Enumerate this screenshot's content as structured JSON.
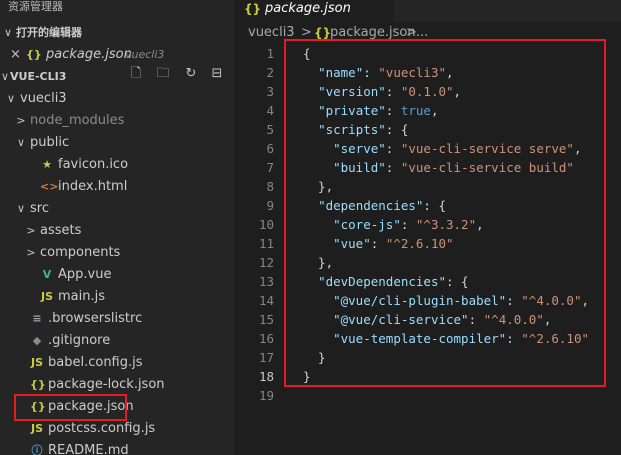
{
  "sidebar": {
    "explorer_title": "资源管理器",
    "open_editors_label": "打开的编辑器",
    "open_editor": {
      "close": "×",
      "icon": "{}",
      "name": "package.json",
      "desc": "vuecli3"
    },
    "project_label": "VUE-CLI3",
    "tree": [
      {
        "label": "vuecli3",
        "chev": "∨",
        "icon": "",
        "dim": false
      },
      {
        "label": "node_modules",
        "chev": ">",
        "icon": "",
        "dim": true
      },
      {
        "label": "public",
        "chev": "∨",
        "icon": "",
        "dim": false
      },
      {
        "label": "favicon.ico",
        "chev": "",
        "icon": "★",
        "dim": false
      },
      {
        "label": "index.html",
        "chev": "",
        "icon": "<>",
        "dim": false
      },
      {
        "label": "src",
        "chev": "∨",
        "icon": "",
        "dim": false
      },
      {
        "label": "assets",
        "chev": ">",
        "icon": "",
        "dim": false
      },
      {
        "label": "components",
        "chev": ">",
        "icon": "",
        "dim": false
      },
      {
        "label": "App.vue",
        "chev": "",
        "icon": "V",
        "dim": false
      },
      {
        "label": "main.js",
        "chev": "",
        "icon": "JS",
        "dim": false
      },
      {
        "label": ".browserslistrc",
        "chev": "",
        "icon": "≡",
        "dim": false
      },
      {
        "label": ".gitignore",
        "chev": "",
        "icon": "◆",
        "dim": false
      },
      {
        "label": "babel.config.js",
        "chev": "",
        "icon": "JS",
        "dim": false
      },
      {
        "label": "package-lock.json",
        "chev": "",
        "icon": "{}",
        "dim": false
      },
      {
        "label": "package.json",
        "chev": "",
        "icon": "{}",
        "dim": false
      },
      {
        "label": "postcss.config.js",
        "chev": "",
        "icon": "JS",
        "dim": false
      },
      {
        "label": "README.md",
        "chev": "",
        "icon": "ⓘ",
        "dim": false
      }
    ]
  },
  "tab": {
    "icon": "{}",
    "label": "package.json"
  },
  "breadcrumb": {
    "folder": "vuecli3",
    "sep1": ">",
    "icon": "{}",
    "file": "package.json",
    "sep2": ">",
    "more": "..."
  },
  "editor": {
    "lines": [
      [
        [
          "p",
          "{"
        ]
      ],
      [
        [
          "p",
          "  "
        ],
        [
          "k",
          "\"name\""
        ],
        [
          "p",
          ": "
        ],
        [
          "s",
          "\"vuecli3\""
        ],
        [
          "p",
          ","
        ]
      ],
      [
        [
          "p",
          "  "
        ],
        [
          "k",
          "\"version\""
        ],
        [
          "p",
          ": "
        ],
        [
          "s",
          "\"0.1.0\""
        ],
        [
          "p",
          ","
        ]
      ],
      [
        [
          "p",
          "  "
        ],
        [
          "k",
          "\"private\""
        ],
        [
          "p",
          ": "
        ],
        [
          "b",
          "true"
        ],
        [
          "p",
          ","
        ]
      ],
      [
        [
          "p",
          "  "
        ],
        [
          "k",
          "\"scripts\""
        ],
        [
          "p",
          ": {"
        ]
      ],
      [
        [
          "p",
          "    "
        ],
        [
          "k",
          "\"serve\""
        ],
        [
          "p",
          ": "
        ],
        [
          "s",
          "\"vue-cli-service serve\""
        ],
        [
          "p",
          ","
        ]
      ],
      [
        [
          "p",
          "    "
        ],
        [
          "k",
          "\"build\""
        ],
        [
          "p",
          ": "
        ],
        [
          "s",
          "\"vue-cli-service build\""
        ]
      ],
      [
        [
          "p",
          "  },"
        ]
      ],
      [
        [
          "p",
          "  "
        ],
        [
          "k",
          "\"dependencies\""
        ],
        [
          "p",
          ": {"
        ]
      ],
      [
        [
          "p",
          "    "
        ],
        [
          "k",
          "\"core-js\""
        ],
        [
          "p",
          ": "
        ],
        [
          "s",
          "\"^3.3.2\""
        ],
        [
          "p",
          ","
        ]
      ],
      [
        [
          "p",
          "    "
        ],
        [
          "k",
          "\"vue\""
        ],
        [
          "p",
          ": "
        ],
        [
          "s",
          "\"^2.6.10\""
        ]
      ],
      [
        [
          "p",
          "  },"
        ]
      ],
      [
        [
          "p",
          "  "
        ],
        [
          "k",
          "\"devDependencies\""
        ],
        [
          "p",
          ": {"
        ]
      ],
      [
        [
          "p",
          "    "
        ],
        [
          "k",
          "\"@vue/cli-plugin-babel\""
        ],
        [
          "p",
          ": "
        ],
        [
          "s",
          "\"^4.0.0\""
        ],
        [
          "p",
          ","
        ]
      ],
      [
        [
          "p",
          "    "
        ],
        [
          "k",
          "\"@vue/cli-service\""
        ],
        [
          "p",
          ": "
        ],
        [
          "s",
          "\"^4.0.0\""
        ],
        [
          "p",
          ","
        ]
      ],
      [
        [
          "p",
          "    "
        ],
        [
          "k",
          "\"vue-template-compiler\""
        ],
        [
          "p",
          ": "
        ],
        [
          "s",
          "\"^2.6.10\""
        ]
      ],
      [
        [
          "p",
          "  }"
        ]
      ],
      [
        [
          "p",
          "}"
        ]
      ],
      [
        [
          "p",
          ""
        ]
      ]
    ],
    "line_numbers": [
      "1",
      "2",
      "3",
      "4",
      "5",
      "6",
      "7",
      "8",
      "9",
      "10",
      "11",
      "12",
      "13",
      "14",
      "15",
      "16",
      "17",
      "18",
      "19"
    ]
  },
  "toolbar_icons": [
    "new-file-icon",
    "new-folder-icon",
    "refresh-icon",
    "collapse-icon"
  ],
  "colors": {
    "highlight": "#e31c23",
    "json_icon": "#cbcb41",
    "js_icon": "#cbcb41",
    "vue_icon": "#41b883",
    "html_icon": "#e37933"
  }
}
